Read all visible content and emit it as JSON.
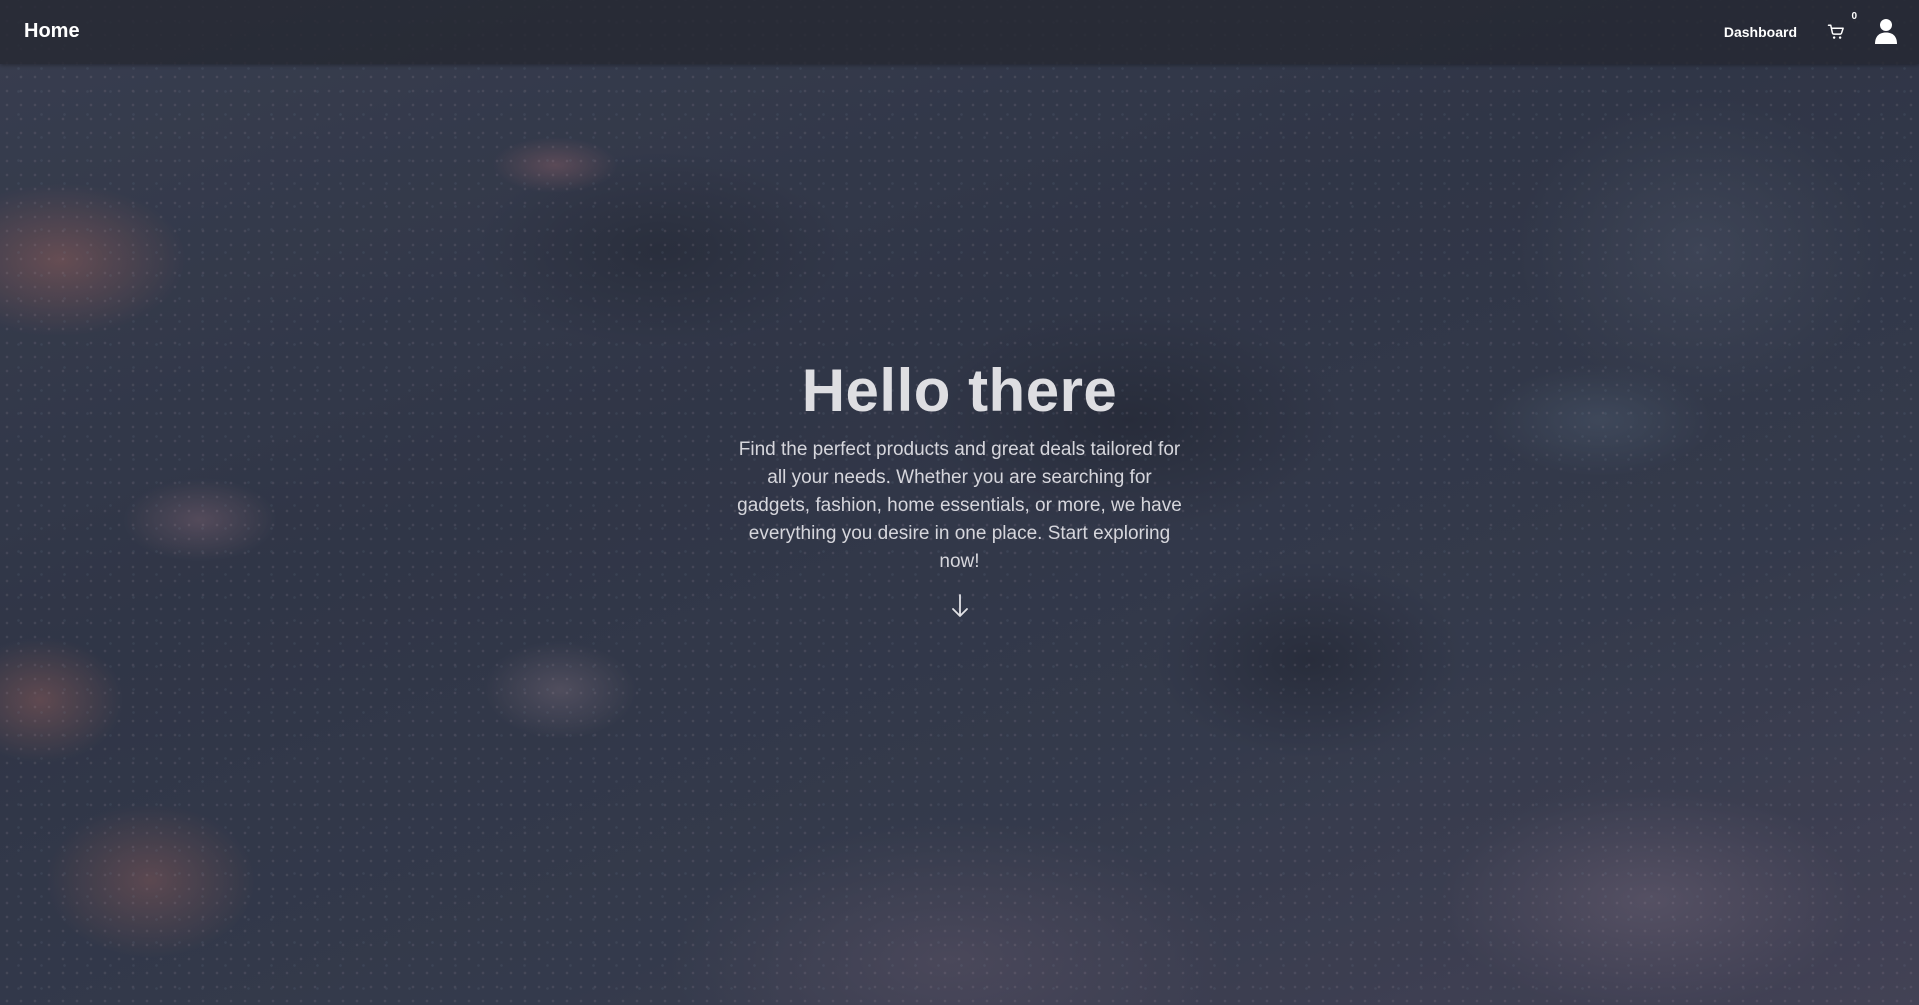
{
  "navbar": {
    "brand": "Home",
    "dashboard_label": "Dashboard",
    "cart_count": "0"
  },
  "hero": {
    "title": "Hello there",
    "description": "Find the perfect products and great deals tailored for all your needs. Whether you are searching for gadgets, fashion, home essentials, or more, we have everything you desire in one place. Start exploring now!"
  },
  "icons": {
    "cart": "cart-icon",
    "account": "user-icon",
    "scroll": "arrow-down-icon"
  },
  "colors": {
    "navbar_bg": "#26283280",
    "text_primary": "#ffffff",
    "hero_title": "#dedee2"
  }
}
